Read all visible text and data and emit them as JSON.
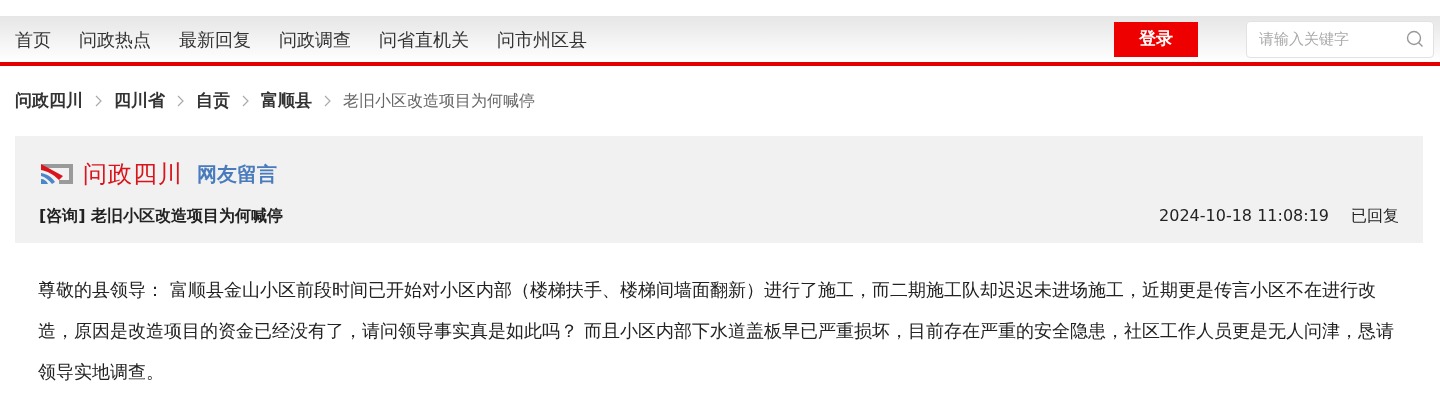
{
  "nav": {
    "items": [
      {
        "label": "首页"
      },
      {
        "label": "问政热点"
      },
      {
        "label": "最新回复"
      },
      {
        "label": "问政调查"
      },
      {
        "label": "问省直机关"
      },
      {
        "label": "问市州区县"
      }
    ],
    "login": "登录",
    "search": {
      "placeholder": "请输入关键字"
    }
  },
  "breadcrumb": [
    {
      "label": "问政四川",
      "kind": "link"
    },
    {
      "label": "四川省",
      "kind": "link"
    },
    {
      "label": "自贡",
      "kind": "link"
    },
    {
      "label": "富顺县",
      "kind": "link"
    },
    {
      "label": "老旧小区改造项目为何喊停",
      "kind": "current"
    }
  ],
  "header": {
    "brand": "问政四川",
    "section": "网友留言",
    "title": "[咨询] 老旧小区改造项目为何喊停",
    "date": "2024-10-18 11:08:19",
    "status": "已回复"
  },
  "body": "尊敬的县领导： 富顺县金山小区前段时间已开始对小区内部（楼梯扶手、楼梯间墙面翻新）进行了施工，而二期施工队却迟迟未进场施工，近期更是传言小区不在进行改造，原因是改造项目的资金已经没有了，请问领导事实真是如此吗？ 而且小区内部下水道盖板早已严重损坏，目前存在严重的安全隐患，社区工作人员更是无人问津，恳请领导实地调查。"
}
